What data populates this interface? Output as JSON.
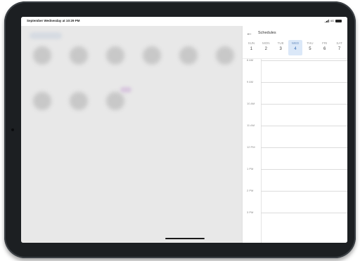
{
  "status_bar": {
    "time_text": "September Wednesday at 10:29 PM",
    "network_text": "4G"
  },
  "schedule_panel": {
    "title": "Schedules",
    "week": [
      {
        "day": "SUN",
        "date": "1",
        "selected": false
      },
      {
        "day": "MON",
        "date": "2",
        "selected": false
      },
      {
        "day": "TUE",
        "date": "3",
        "selected": false
      },
      {
        "day": "WED",
        "date": "4",
        "selected": true
      },
      {
        "day": "THU",
        "date": "5",
        "selected": false
      },
      {
        "day": "FRI",
        "date": "6",
        "selected": false
      },
      {
        "day": "SAT",
        "date": "7",
        "selected": false
      }
    ],
    "time_slots": [
      "8 AM",
      "9 AM",
      "10 AM",
      "11 AM",
      "12 PM",
      "1 PM",
      "2 PM",
      "3 PM"
    ]
  },
  "colors": {
    "selected_day_bg": "#dbe8f8",
    "selected_day_text": "#3f73b8",
    "device_frame": "#1c1f22"
  }
}
